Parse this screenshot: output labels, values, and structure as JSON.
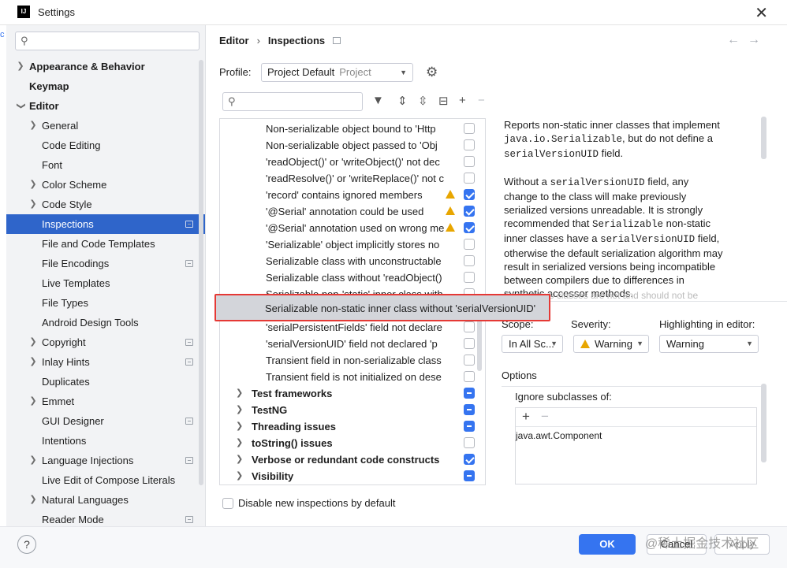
{
  "window": {
    "title": "Settings",
    "app_icon": "IJ"
  },
  "sidebar": {
    "search_placeholder": "",
    "items": [
      {
        "label": "Appearance & Behavior"
      },
      {
        "label": "Keymap"
      },
      {
        "label": "Editor"
      },
      {
        "label": "General"
      },
      {
        "label": "Code Editing"
      },
      {
        "label": "Font"
      },
      {
        "label": "Color Scheme"
      },
      {
        "label": "Code Style"
      },
      {
        "label": "Inspections"
      },
      {
        "label": "File and Code Templates"
      },
      {
        "label": "File Encodings"
      },
      {
        "label": "Live Templates"
      },
      {
        "label": "File Types"
      },
      {
        "label": "Android Design Tools"
      },
      {
        "label": "Copyright"
      },
      {
        "label": "Inlay Hints"
      },
      {
        "label": "Duplicates"
      },
      {
        "label": "Emmet"
      },
      {
        "label": "GUI Designer"
      },
      {
        "label": "Intentions"
      },
      {
        "label": "Language Injections"
      },
      {
        "label": "Live Edit of Compose Literals"
      },
      {
        "label": "Natural Languages"
      },
      {
        "label": "Reader Mode"
      }
    ]
  },
  "breadcrumb": {
    "parent": "Editor",
    "current": "Inspections"
  },
  "profile": {
    "label": "Profile:",
    "value": "Project Default",
    "sub": "Project"
  },
  "inspections": {
    "rows": [
      {
        "label": "Non-serializable object bound to 'Http",
        "checked": false
      },
      {
        "label": "Non-serializable object passed to 'Obj",
        "checked": false
      },
      {
        "label": "'readObject()' or 'writeObject()' not dec",
        "checked": false
      },
      {
        "label": "'readResolve()' or 'writeReplace()' not c",
        "checked": false
      },
      {
        "label": "'record' contains ignored members",
        "checked": true,
        "warn": true
      },
      {
        "label": "'@Serial' annotation could be used",
        "checked": true,
        "warn": true
      },
      {
        "label": "'@Serial' annotation used on wrong me",
        "checked": true,
        "warn": true
      },
      {
        "label": "'Serializable' object implicitly stores no",
        "checked": false
      },
      {
        "label": "Serializable class with unconstructable",
        "checked": false
      },
      {
        "label": "Serializable class without 'readObject()",
        "checked": false
      },
      {
        "label": "Serializable non-'static' inner class with",
        "checked": false
      },
      {
        "label": "Serializable non-static inner class without 'serialVersionUID'",
        "checked": false,
        "highlighted": true
      },
      {
        "label": "'serialPersistentFields' field not declare",
        "checked": false
      },
      {
        "label": "'serialVersionUID' field not declared 'p",
        "checked": false
      },
      {
        "label": "Transient field in non-serializable class",
        "checked": false
      },
      {
        "label": "Transient field is not initialized on dese",
        "checked": false
      }
    ],
    "groups": [
      {
        "label": "Test frameworks",
        "state": "mixed"
      },
      {
        "label": "TestNG",
        "state": "mixed"
      },
      {
        "label": "Threading issues",
        "state": "mixed"
      },
      {
        "label": "toString() issues",
        "state": "off"
      },
      {
        "label": "Verbose or redundant code constructs",
        "state": "on"
      },
      {
        "label": "Visibility",
        "state": "mixed"
      }
    ]
  },
  "description": {
    "p1a": "Reports non-static inner classes that implement",
    "p1_code1": "java.io.Serializable",
    "p1b": ", but do not define a",
    "p1_code2": "serialVersionUID",
    "p1c": " field.",
    "p2a": "Without a",
    "p2_code1": "serialVersionUID",
    "p2b": "field, any change to the class will make previously serialized versions unreadable. It is strongly recommended that",
    "p2_code2": "Serializable",
    "p2c": "non-static inner classes have a",
    "p2_code3": "serialVersionUID",
    "p2d": "field, otherwise the default serialization algorithm may result in serialized versions being incompatible between compilers due to differences in synthetic accessor methods.",
    "fade": "Anonymous classes are not and should not be serializable."
  },
  "settings": {
    "scope_label": "Scope:",
    "scope_value": "In All Sc...",
    "severity_label": "Severity:",
    "severity_value": "Warning",
    "highlight_label": "Highlighting in editor:",
    "highlight_value": "Warning",
    "options_label": "Options",
    "ignore_label": "Ignore subclasses of:",
    "ignore_items": [
      "java.awt.Component"
    ]
  },
  "default_checkbox_label": "Disable new inspections by default",
  "footer": {
    "help": "?",
    "ok": "OK",
    "cancel": "Cancel",
    "apply": "Apply"
  },
  "watermark": "@稀土掘金技术社区",
  "colors": {
    "accent": "#3574f0",
    "selection": "#2f65ca",
    "highlight_box": "#e53935",
    "warning": "#e8a600"
  }
}
